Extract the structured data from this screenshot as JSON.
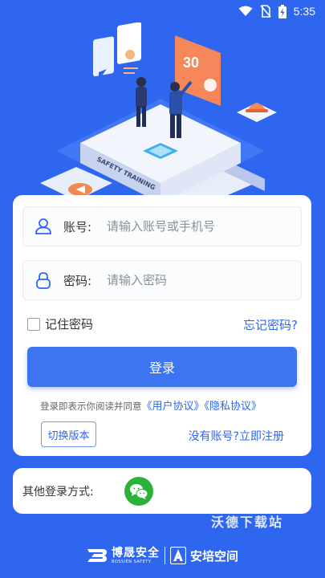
{
  "status_bar": {
    "time": "5:35"
  },
  "hero": {
    "board_number": "30",
    "platform_text": "SAFETY TRAINING"
  },
  "login": {
    "account_label": "账号:",
    "account_placeholder": "请输入账号或手机号",
    "password_label": "密码:",
    "password_placeholder": "请输入密码",
    "remember_label": "记住密码",
    "forgot_label": "忘记密码?",
    "login_button": "登录",
    "agreement_prefix": "登录即表示你阅读并同意",
    "user_agreement": "《用户协议》",
    "privacy_agreement": "《隐私协议》",
    "switch_version": "切换版本",
    "register_link": "没有账号?立即注册"
  },
  "other_login": {
    "label": "其他登录方式:",
    "wechat_icon": "wechat-icon"
  },
  "watermark": "沃德下载站",
  "footer": {
    "brand1_name": "博晟安全",
    "brand1_sub": "BOSSIEN SAFETY",
    "brand2_name": "安培空间"
  },
  "colors": {
    "primary": "#2f66f0",
    "wechat": "#2ab239"
  }
}
